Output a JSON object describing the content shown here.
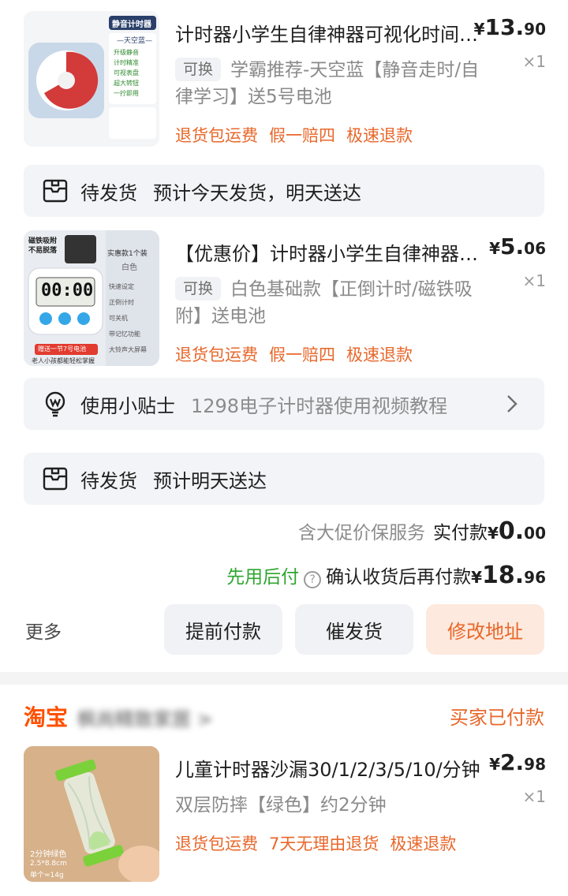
{
  "items": [
    {
      "title": "计时器小学生自律神器可视化时间管理",
      "price_int": "13.",
      "price_dec": "90",
      "currency": "¥",
      "qty": "×1",
      "swap": "可换",
      "spec": "学霸推荐-天空蓝【静音走时/自律学习】送5号电池",
      "tags": [
        "退货包运费",
        "假一赔四",
        "极速退款"
      ],
      "thumb_text_top": "静音计时器",
      "thumb_text_sub": "—天空蓝—",
      "thumb_features": [
        "升级静音",
        "计时精准",
        "可视表盘",
        "超大转钮",
        "一拧即用"
      ]
    },
    {
      "title": "【优惠价】计时器小学生自律神器厨房",
      "price_int": "5.",
      "price_dec": "06",
      "currency": "¥",
      "qty": "×1",
      "swap": "可换",
      "spec": "白色基础款【正倒计时/磁铁吸附】送电池",
      "tags": [
        "退货包运费",
        "假一赔四",
        "极速退款"
      ],
      "thumb_text_top": "磁铁吸附 不易脱落",
      "thumb_badge": "实惠款1个装",
      "thumb_badge2": "白色",
      "thumb_digits": "00:00",
      "thumb_features": [
        "快速设定",
        "正倒计时",
        "可关机",
        "带记忆功能",
        "大铃声大屏幕"
      ],
      "thumb_footer": "赠送一节7号电池",
      "thumb_footer2": "老人小孩都能轻松掌握"
    },
    {
      "title": "儿童计时器沙漏30/1/2/3/5/10/分钟",
      "price_int": "2.",
      "price_dec": "98",
      "currency": "¥",
      "qty": "×1",
      "spec": "双层防摔【绿色】约2分钟",
      "tags": [
        "退货包运费",
        "7天无理由退货",
        "极速退款"
      ],
      "thumb_caption": "2分钟绿色",
      "thumb_caption2": "2.5*8.8cm",
      "thumb_caption3": "单个≈14g"
    }
  ],
  "ship1": {
    "status": "待发货",
    "eta": "预计今天发货，明天送达"
  },
  "tips": {
    "label": "使用小贴士",
    "text": "1298电子计时器使用视频教程"
  },
  "ship2": {
    "status": "待发货",
    "eta": "预计明天送达"
  },
  "totals": {
    "insured": "含大促价保服务",
    "paid_label": "实付款",
    "paid_yen": "¥",
    "paid_int": "0.",
    "paid_dec": "00",
    "pay_later": "先用后付",
    "help_icon": "?",
    "pay_after": "确认收货后再付款",
    "due_yen": "¥",
    "due_int": "18.",
    "due_dec": "96"
  },
  "actions": {
    "more": "更多",
    "prepay": "提前付款",
    "urge": "催发货",
    "change_address": "修改地址"
  },
  "shop": {
    "logo": "淘宝",
    "name": "枫尚精致家居 >",
    "status": "买家已付款"
  },
  "colors": {
    "accent": "#e8672a",
    "green": "#2fa52f",
    "taobao": "#ff5000",
    "bar_bg": "#f2f4f8"
  }
}
